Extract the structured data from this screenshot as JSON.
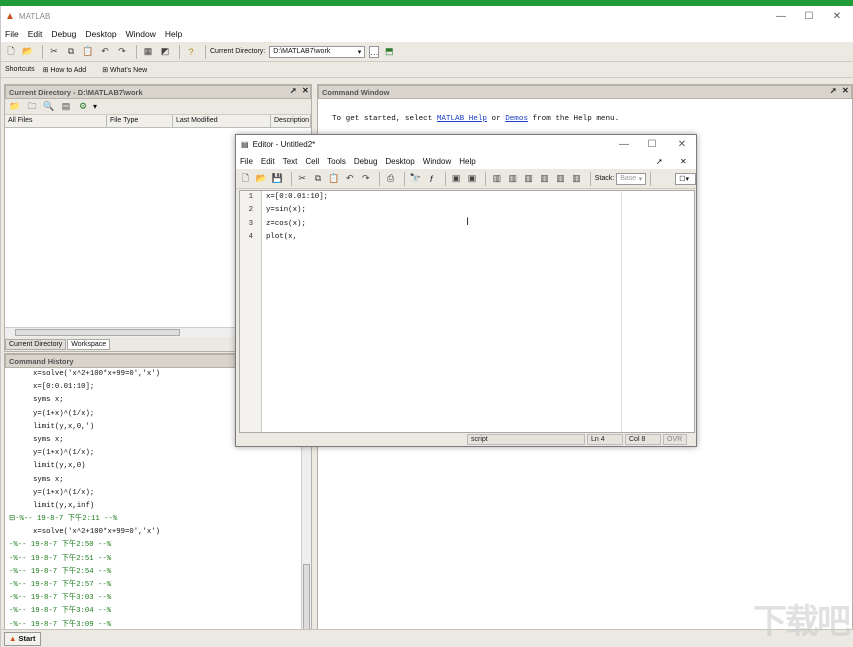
{
  "app": {
    "title": "MATLAB",
    "menu": [
      "File",
      "Edit",
      "Debug",
      "Desktop",
      "Window",
      "Help"
    ],
    "current_directory_label": "Current Directory:",
    "current_directory_value": "D:\\MATLAB7\\work",
    "shortcuts": [
      "Shortcuts",
      "How to Add",
      "What's New"
    ],
    "start_label": "Start"
  },
  "current_dir_panel": {
    "title": "Current Directory - D:\\MATLAB7\\work",
    "columns": [
      "All Files",
      "File Type",
      "Last Modified",
      "Description"
    ],
    "tabs": [
      "Current Directory",
      "Workspace"
    ]
  },
  "command_history": {
    "title": "Command History",
    "lines": [
      {
        "type": "cmd",
        "text": "x=solve('x^2+100*x+99=0','x')"
      },
      {
        "type": "cmd",
        "text": "x=[0:0.01:10];"
      },
      {
        "type": "cmd",
        "text": "syms x;"
      },
      {
        "type": "cmd",
        "text": "y=(1+x)^(1/x);"
      },
      {
        "type": "cmd",
        "text": "limit(y,x,0,')"
      },
      {
        "type": "cmd",
        "text": "syms x;"
      },
      {
        "type": "cmd",
        "text": "y=(1+x)^(1/x);"
      },
      {
        "type": "cmd",
        "text": "limit(y,x,0)"
      },
      {
        "type": "cmd",
        "text": "syms x;"
      },
      {
        "type": "cmd",
        "text": "y=(1+x)^(1/x);"
      },
      {
        "type": "cmd",
        "text": "limit(y,x,inf)"
      },
      {
        "type": "ts",
        "text": "⊟-%-- 19-8-7 下午2:11 --%"
      },
      {
        "type": "cmd",
        "text": "x=solve('x^2+100*x+99=0','x')"
      },
      {
        "type": "ts",
        "text": "-%-- 19-8-7 下午2:50 --%"
      },
      {
        "type": "ts",
        "text": "-%-- 19-8-7 下午2:51 --%"
      },
      {
        "type": "ts",
        "text": "-%-- 19-8-7 下午2:54 --%"
      },
      {
        "type": "ts",
        "text": "-%-- 19-8-7 下午2:57 --%"
      },
      {
        "type": "ts",
        "text": "-%-- 19-8-7 下午3:03 --%"
      },
      {
        "type": "ts",
        "text": "-%-- 19-8-7 下午3:04 --%"
      },
      {
        "type": "ts",
        "text": "-%-- 19-8-7 下午3:09 --%"
      }
    ]
  },
  "command_window": {
    "title": "Command Window",
    "intro_before": "To get started, select ",
    "link1": "MATLAB Help",
    "intro_mid": " or ",
    "link2": "Demos",
    "intro_after": " from the Help menu."
  },
  "editor": {
    "title": "Editor - Untitled2*",
    "menu": [
      "File",
      "Edit",
      "Text",
      "Cell",
      "Tools",
      "Debug",
      "Desktop",
      "Window",
      "Help"
    ],
    "stack_label": "Stack:",
    "stack_value": "Base",
    "line_numbers": [
      "1",
      "2",
      "3",
      "4"
    ],
    "code": [
      "x=[0:0.01:10];",
      "y=sin(x);",
      "z=cos(x);",
      "plot(x,"
    ],
    "status_mode": "script",
    "status_ln": "Ln   4",
    "status_col": "Col   8",
    "status_ovr": "OVR"
  },
  "watermark": "下载吧"
}
